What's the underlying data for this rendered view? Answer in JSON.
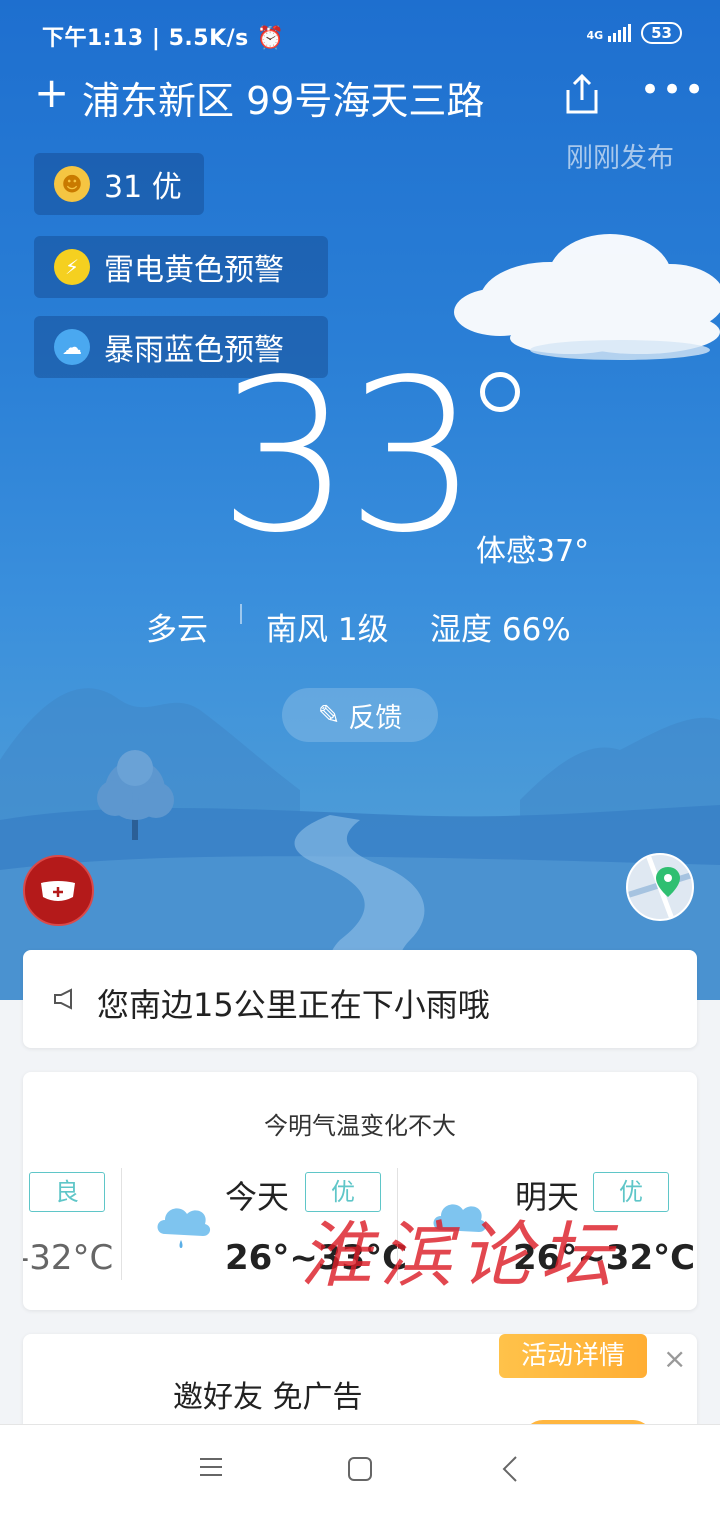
{
  "status_bar": {
    "time": "下午1:13",
    "net_speed": "5.5K/s",
    "dots": "··",
    "network": "4G",
    "battery": "53"
  },
  "header": {
    "add": "+",
    "location": "浦东新区 99号海天三路",
    "published": "刚刚发布"
  },
  "chips": {
    "aqi": "31 优",
    "warning1": "雷电黄色预警",
    "warning2": "暴雨蓝色预警"
  },
  "current": {
    "temp": "33",
    "feels_like": "体感37°",
    "condition": "多云",
    "wind": "南风 1级",
    "humidity": "湿度 66%"
  },
  "feedback_label": "反馈",
  "notice": "您南边15公里正在下小雨哦",
  "forecast": {
    "heading": "今明气温变化不大",
    "prev": {
      "badge": "良",
      "range": "-32°C"
    },
    "today": {
      "label": "今天",
      "badge": "优",
      "range": "26°~33°C"
    },
    "tomorrow": {
      "label": "明天",
      "badge": "优",
      "range": "26°~32°C"
    }
  },
  "promo": {
    "text": "邀好友 免广告",
    "tag": "活动详情",
    "close": "×"
  },
  "watermark": "淮滨论坛",
  "colors": {
    "sky_top": "#1e6fcf",
    "badge_teal": "#5fc6c8",
    "promo_orange": "#ffb640",
    "mask_red": "#b41a1a"
  }
}
